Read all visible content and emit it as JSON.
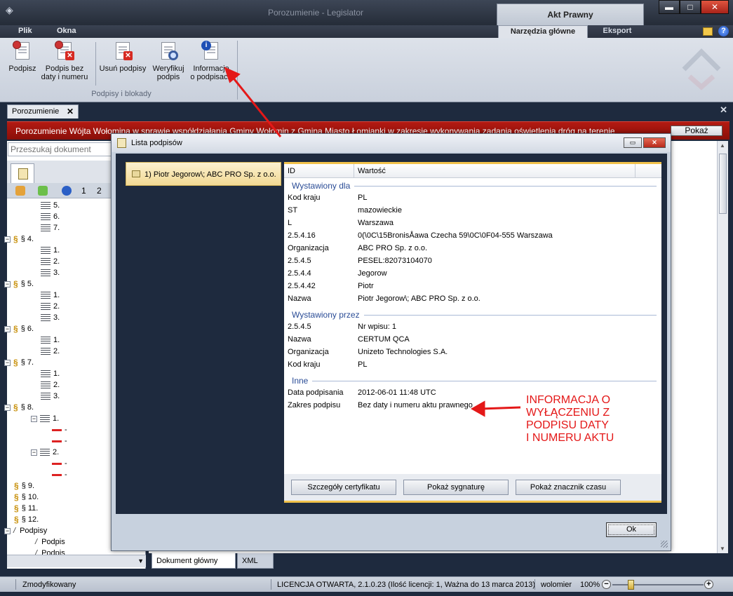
{
  "window": {
    "title": "Porozumienie - Legislator",
    "contextual_group": "Akt Prawny",
    "controls": {
      "minimize": "▬",
      "maximize": "□",
      "close": "✕"
    }
  },
  "menu": {
    "file": "Plik",
    "windows": "Okna"
  },
  "ribbon": {
    "tabs": [
      {
        "label": "Narzędzia główne",
        "active": true
      },
      {
        "label": "Eksport",
        "active": false
      }
    ],
    "buttons": {
      "sign": "Podpisz",
      "sign_no_date_1": "Podpis bez",
      "sign_no_date_2": "daty i numeru",
      "remove": "Usuń podpisy",
      "verify_1": "Weryfikuj",
      "verify_2": "podpis",
      "info_1": "Informacje",
      "info_2": "o podpisach"
    },
    "group_label": "Podpisy i blokady",
    "icons": {
      "folder": "folder-icon",
      "help": "?"
    }
  },
  "document_tab": {
    "label": "Porozumienie",
    "close": "✕"
  },
  "close_all": "✕",
  "banner": {
    "text": "Porozumienie Wójta Wołomina w sprawie współdziałania Gminy Wołomin z Gminą Miasto Łomianki w zakresie wykonywania zadania oświetlenia dróg na terenie",
    "button": "Pokaż",
    "color": "#a3150d"
  },
  "left_pane": {
    "search_placeholder": "Przeszukaj dokument",
    "tool_numbers": [
      "1",
      "2"
    ],
    "tree": [
      {
        "label": "5.",
        "kind": "item",
        "depth": 2
      },
      {
        "label": "6.",
        "kind": "item",
        "depth": 2
      },
      {
        "label": "7.",
        "kind": "item",
        "depth": 2
      },
      {
        "label": "§ 4.",
        "kind": "para",
        "depth": 1,
        "pm": "−"
      },
      {
        "label": "1.",
        "kind": "item",
        "depth": 2
      },
      {
        "label": "2.",
        "kind": "item",
        "depth": 2
      },
      {
        "label": "3.",
        "kind": "item",
        "depth": 2
      },
      {
        "label": "§ 5.",
        "kind": "para",
        "depth": 1,
        "pm": "−"
      },
      {
        "label": "1.",
        "kind": "item",
        "depth": 2
      },
      {
        "label": "2.",
        "kind": "item",
        "depth": 2
      },
      {
        "label": "3.",
        "kind": "item",
        "depth": 2
      },
      {
        "label": "§ 6.",
        "kind": "para",
        "depth": 1,
        "pm": "−"
      },
      {
        "label": "1.",
        "kind": "item",
        "depth": 2
      },
      {
        "label": "2.",
        "kind": "item",
        "depth": 2
      },
      {
        "label": "§ 7.",
        "kind": "para",
        "depth": 1,
        "pm": "−"
      },
      {
        "label": "1.",
        "kind": "item",
        "depth": 2
      },
      {
        "label": "2.",
        "kind": "item",
        "depth": 2
      },
      {
        "label": "3.",
        "kind": "item",
        "depth": 2
      },
      {
        "label": "§ 8.",
        "kind": "para",
        "depth": 1,
        "pm": "−"
      },
      {
        "label": "1.",
        "kind": "item",
        "depth": 2,
        "pm": "−"
      },
      {
        "label": "-",
        "kind": "dash",
        "depth": 3
      },
      {
        "label": "-",
        "kind": "dash",
        "depth": 3
      },
      {
        "label": "2.",
        "kind": "item",
        "depth": 2,
        "pm": "−"
      },
      {
        "label": "-",
        "kind": "dash",
        "depth": 3
      },
      {
        "label": "-",
        "kind": "dash",
        "depth": 3
      },
      {
        "label": "§ 9.",
        "kind": "para",
        "depth": 1
      },
      {
        "label": "§ 10.",
        "kind": "para",
        "depth": 1
      },
      {
        "label": "§ 11.",
        "kind": "para",
        "depth": 1
      },
      {
        "label": "§ 12.",
        "kind": "para",
        "depth": 1
      },
      {
        "label": "Podpisy",
        "kind": "sig",
        "depth": 1,
        "pm": "−"
      },
      {
        "label": "Podpis",
        "kind": "sig",
        "depth": 2
      },
      {
        "label": "Podpis",
        "kind": "sig",
        "depth": 2
      }
    ]
  },
  "bottom_tabs": [
    {
      "label": "Dokument główny",
      "active": true
    },
    {
      "label": "XML",
      "active": false
    }
  ],
  "status": {
    "state": "Zmodyfikowany",
    "license": "LICENCJA OTWARTA, 2.1.0.23 (Ilość licencji: 1, Ważna do 13 marca 2013)",
    "user": "wolomier",
    "zoom": "100%",
    "zoom_minus": "−",
    "zoom_plus": "+"
  },
  "dialog": {
    "title": "Lista podpisów",
    "signature_item": "1) Piotr Jegorow\\; ABC PRO Sp. z o.o.",
    "columns": [
      "ID",
      "Wartość"
    ],
    "sections": [
      {
        "title": "Wystawiony dla",
        "rows": [
          {
            "k": "Kod kraju",
            "v": "PL"
          },
          {
            "k": "ST",
            "v": "mazowieckie"
          },
          {
            "k": "L",
            "v": "Warszawa"
          },
          {
            "k": "2.5.4.16",
            "v": "0(\\0C\\15BronisÅawa Czecha 59\\0C\\0F04-555 Warszawa"
          },
          {
            "k": "Organizacja",
            "v": "ABC PRO Sp. z o.o."
          },
          {
            "k": "2.5.4.5",
            "v": "PESEL:82073104070"
          },
          {
            "k": "2.5.4.4",
            "v": "Jegorow"
          },
          {
            "k": "2.5.4.42",
            "v": "Piotr"
          },
          {
            "k": "Nazwa",
            "v": "Piotr Jegorow\\; ABC PRO Sp. z o.o."
          }
        ]
      },
      {
        "title": "Wystawiony przez",
        "rows": [
          {
            "k": "2.5.4.5",
            "v": "Nr wpisu: 1"
          },
          {
            "k": "Nazwa",
            "v": "CERTUM QCA"
          },
          {
            "k": "Organizacja",
            "v": "Unizeto Technologies S.A."
          },
          {
            "k": "Kod kraju",
            "v": "PL"
          }
        ]
      },
      {
        "title": "Inne",
        "rows": [
          {
            "k": "Data podpisania",
            "v": "2012-06-01 11:48 UTC"
          },
          {
            "k": "Zakres podpisu",
            "v": "Bez daty i numeru aktu prawnego"
          }
        ]
      }
    ],
    "buttons": {
      "cert": "Szczegóły certyfikatu",
      "signature": "Pokaż sygnaturę",
      "timestamp": "Pokaż znacznik czasu",
      "ok": "Ok"
    }
  },
  "annotation": {
    "lines": [
      "INFORMACJA O",
      "WYŁĄCZENIU Z",
      "PODPISU DATY",
      "I NUMERU AKTU"
    ],
    "color": "#e41818"
  }
}
